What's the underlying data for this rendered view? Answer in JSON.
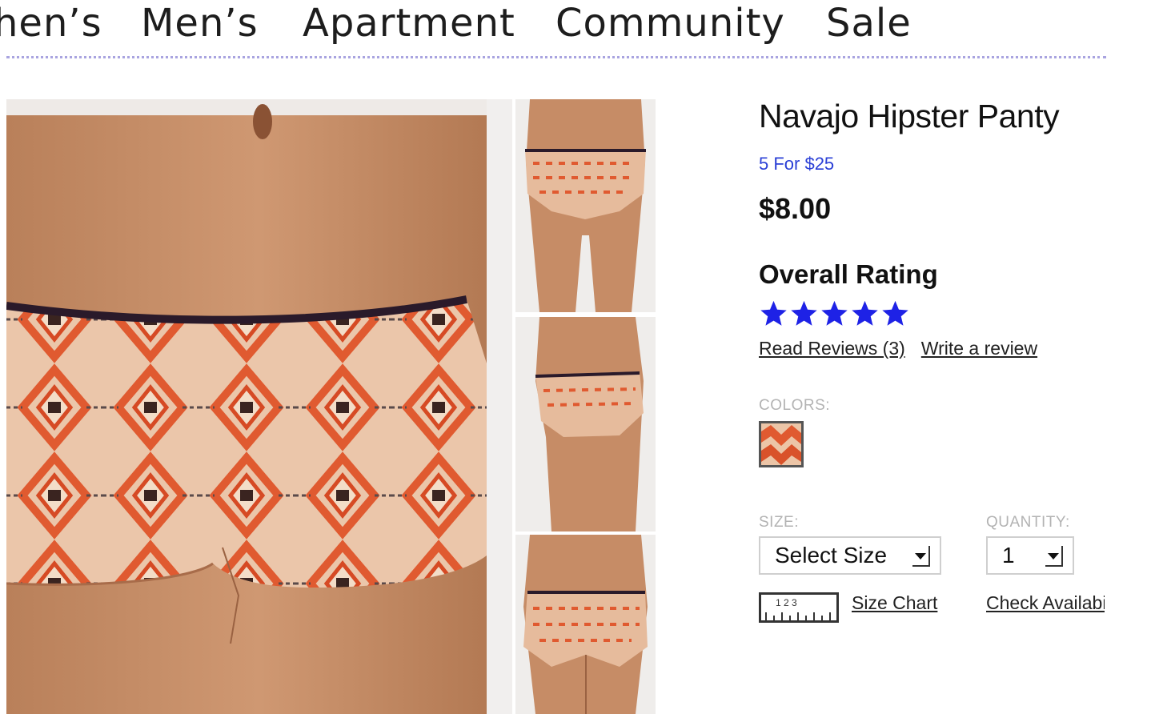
{
  "nav": {
    "items": [
      "hen’s",
      "Men’s",
      "Apartment",
      "Community",
      "Sale"
    ]
  },
  "product": {
    "title": "Navajo Hipster Panty",
    "promo": "5 For $25",
    "price": "$8.00",
    "rating_label": "Overall Rating",
    "rating_stars": 5,
    "rating_max": 5,
    "read_reviews": "Read Reviews (3)",
    "write_review": "Write a review",
    "colors_label": "COLORS:",
    "size_label": "SIZE:",
    "size_select_value": "Select Size",
    "quantity_label": "QUANTITY:",
    "quantity_value": "1",
    "size_chart": "Size Chart",
    "check_availability": "Check Availability",
    "ruler_digits": "1 2 3"
  },
  "colors": {
    "star": "#1e22e6",
    "promo_link": "#2a3fd6",
    "nav_divider": "#a9a4e0",
    "fabric_base": "#e9c2a6",
    "fabric_pattern": "#e05a30",
    "waistband": "#2a1a2a",
    "skin": "#c68c66"
  }
}
